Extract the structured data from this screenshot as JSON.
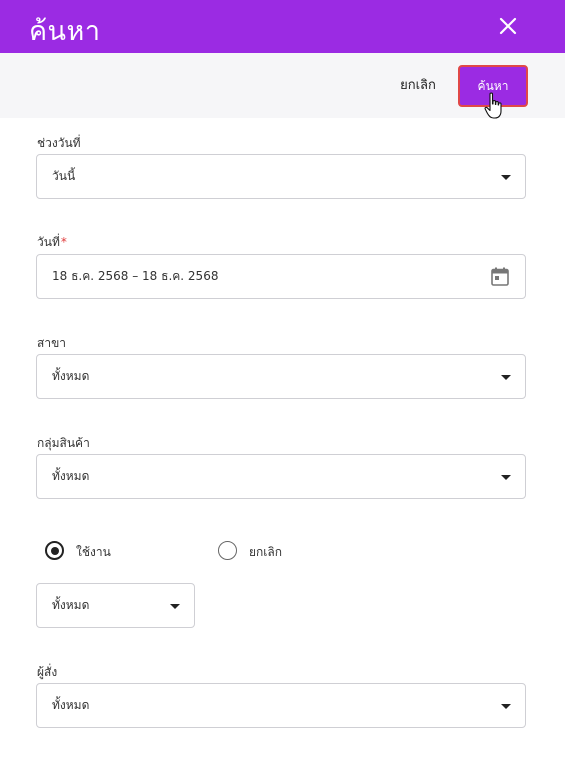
{
  "header": {
    "title": "ค้นหา",
    "close_icon": "close-icon"
  },
  "toolbar": {
    "cancel_label": "ยกเลิก",
    "search_label": "ค้นหา"
  },
  "colors": {
    "accent": "#9b2be3",
    "highlight_border": "#e04848",
    "required": "#e03b3b"
  },
  "form": {
    "date_range": {
      "label": "ช่วงวันที่",
      "value": "วันนี้"
    },
    "date": {
      "label": "วันที่",
      "required_mark": "*",
      "value": "18 ธ.ค. 2568 – 18 ธ.ค. 2568",
      "icon": "calendar-icon"
    },
    "branch": {
      "label": "สาขา",
      "value": "ทั้งหมด"
    },
    "product_group": {
      "label": "กลุ่มสินค้า",
      "value": "ทั้งหมด"
    },
    "status": {
      "options": [
        {
          "label": "ใช้งาน",
          "checked": true
        },
        {
          "label": "ยกเลิก",
          "checked": false
        }
      ],
      "value": "ทั้งหมด"
    },
    "orderer": {
      "label": "ผู้สั่ง",
      "value": "ทั้งหมด"
    }
  }
}
